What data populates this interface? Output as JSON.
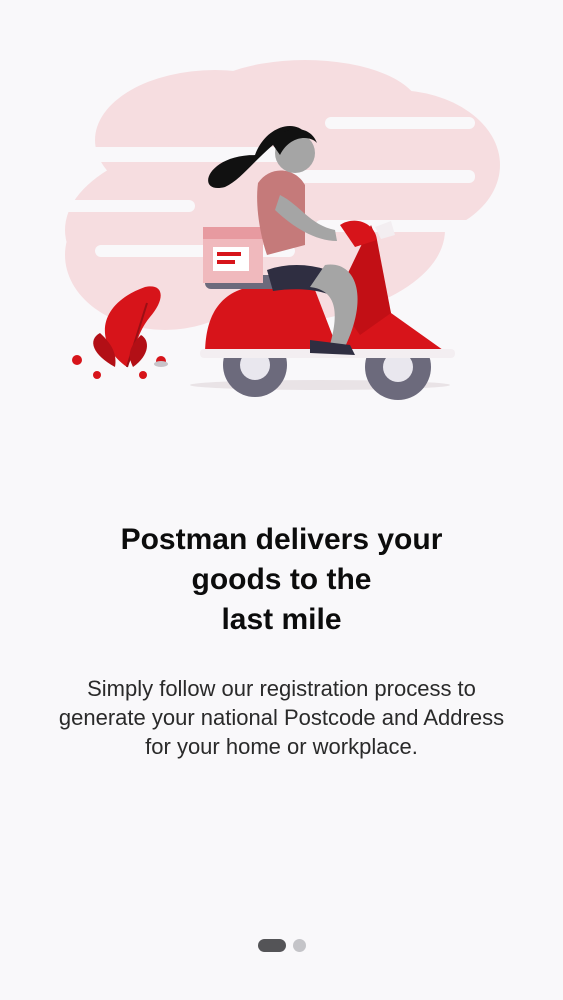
{
  "onboarding": {
    "illustration_name": "delivery-woman-on-scooter",
    "title_lines": [
      "Postman delivers your",
      "goods to the",
      "last mile"
    ],
    "description_lines": [
      "Simply follow our registration process to",
      "generate your national Postcode and Address",
      "for your home or workplace."
    ],
    "pager": {
      "total_pages": 2,
      "current_page": 1
    }
  },
  "colors": {
    "background": "#f9f8fa",
    "accent_red": "#d7141a",
    "soft_pink": "#f4dcdf",
    "title_text": "#0c0c0c",
    "body_text": "#2a2a2a",
    "dot_active": "#545457",
    "dot_inactive": "#c4c4c8"
  }
}
